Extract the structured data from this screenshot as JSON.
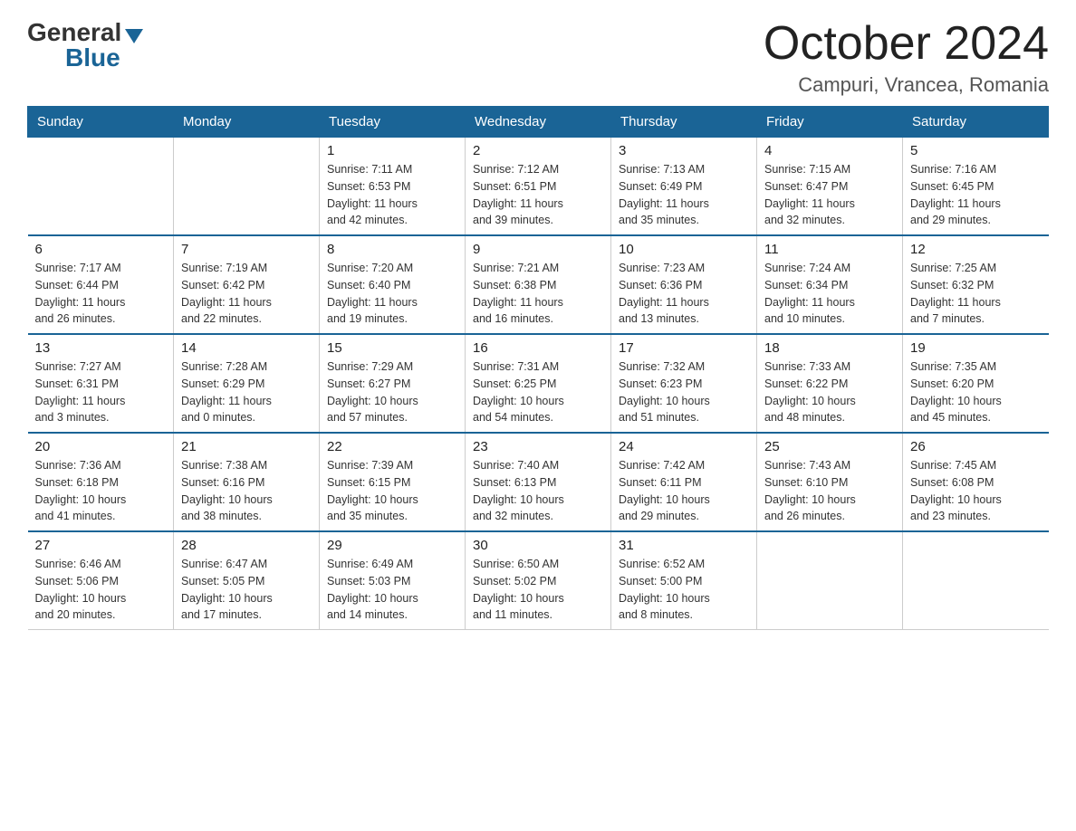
{
  "header": {
    "logo": {
      "general": "General",
      "blue": "Blue"
    },
    "title": "October 2024",
    "location": "Campuri, Vrancea, Romania"
  },
  "days_of_week": [
    "Sunday",
    "Monday",
    "Tuesday",
    "Wednesday",
    "Thursday",
    "Friday",
    "Saturday"
  ],
  "weeks": [
    [
      {
        "day": "",
        "info": ""
      },
      {
        "day": "",
        "info": ""
      },
      {
        "day": "1",
        "info": "Sunrise: 7:11 AM\nSunset: 6:53 PM\nDaylight: 11 hours\nand 42 minutes."
      },
      {
        "day": "2",
        "info": "Sunrise: 7:12 AM\nSunset: 6:51 PM\nDaylight: 11 hours\nand 39 minutes."
      },
      {
        "day": "3",
        "info": "Sunrise: 7:13 AM\nSunset: 6:49 PM\nDaylight: 11 hours\nand 35 minutes."
      },
      {
        "day": "4",
        "info": "Sunrise: 7:15 AM\nSunset: 6:47 PM\nDaylight: 11 hours\nand 32 minutes."
      },
      {
        "day": "5",
        "info": "Sunrise: 7:16 AM\nSunset: 6:45 PM\nDaylight: 11 hours\nand 29 minutes."
      }
    ],
    [
      {
        "day": "6",
        "info": "Sunrise: 7:17 AM\nSunset: 6:44 PM\nDaylight: 11 hours\nand 26 minutes."
      },
      {
        "day": "7",
        "info": "Sunrise: 7:19 AM\nSunset: 6:42 PM\nDaylight: 11 hours\nand 22 minutes."
      },
      {
        "day": "8",
        "info": "Sunrise: 7:20 AM\nSunset: 6:40 PM\nDaylight: 11 hours\nand 19 minutes."
      },
      {
        "day": "9",
        "info": "Sunrise: 7:21 AM\nSunset: 6:38 PM\nDaylight: 11 hours\nand 16 minutes."
      },
      {
        "day": "10",
        "info": "Sunrise: 7:23 AM\nSunset: 6:36 PM\nDaylight: 11 hours\nand 13 minutes."
      },
      {
        "day": "11",
        "info": "Sunrise: 7:24 AM\nSunset: 6:34 PM\nDaylight: 11 hours\nand 10 minutes."
      },
      {
        "day": "12",
        "info": "Sunrise: 7:25 AM\nSunset: 6:32 PM\nDaylight: 11 hours\nand 7 minutes."
      }
    ],
    [
      {
        "day": "13",
        "info": "Sunrise: 7:27 AM\nSunset: 6:31 PM\nDaylight: 11 hours\nand 3 minutes."
      },
      {
        "day": "14",
        "info": "Sunrise: 7:28 AM\nSunset: 6:29 PM\nDaylight: 11 hours\nand 0 minutes."
      },
      {
        "day": "15",
        "info": "Sunrise: 7:29 AM\nSunset: 6:27 PM\nDaylight: 10 hours\nand 57 minutes."
      },
      {
        "day": "16",
        "info": "Sunrise: 7:31 AM\nSunset: 6:25 PM\nDaylight: 10 hours\nand 54 minutes."
      },
      {
        "day": "17",
        "info": "Sunrise: 7:32 AM\nSunset: 6:23 PM\nDaylight: 10 hours\nand 51 minutes."
      },
      {
        "day": "18",
        "info": "Sunrise: 7:33 AM\nSunset: 6:22 PM\nDaylight: 10 hours\nand 48 minutes."
      },
      {
        "day": "19",
        "info": "Sunrise: 7:35 AM\nSunset: 6:20 PM\nDaylight: 10 hours\nand 45 minutes."
      }
    ],
    [
      {
        "day": "20",
        "info": "Sunrise: 7:36 AM\nSunset: 6:18 PM\nDaylight: 10 hours\nand 41 minutes."
      },
      {
        "day": "21",
        "info": "Sunrise: 7:38 AM\nSunset: 6:16 PM\nDaylight: 10 hours\nand 38 minutes."
      },
      {
        "day": "22",
        "info": "Sunrise: 7:39 AM\nSunset: 6:15 PM\nDaylight: 10 hours\nand 35 minutes."
      },
      {
        "day": "23",
        "info": "Sunrise: 7:40 AM\nSunset: 6:13 PM\nDaylight: 10 hours\nand 32 minutes."
      },
      {
        "day": "24",
        "info": "Sunrise: 7:42 AM\nSunset: 6:11 PM\nDaylight: 10 hours\nand 29 minutes."
      },
      {
        "day": "25",
        "info": "Sunrise: 7:43 AM\nSunset: 6:10 PM\nDaylight: 10 hours\nand 26 minutes."
      },
      {
        "day": "26",
        "info": "Sunrise: 7:45 AM\nSunset: 6:08 PM\nDaylight: 10 hours\nand 23 minutes."
      }
    ],
    [
      {
        "day": "27",
        "info": "Sunrise: 6:46 AM\nSunset: 5:06 PM\nDaylight: 10 hours\nand 20 minutes."
      },
      {
        "day": "28",
        "info": "Sunrise: 6:47 AM\nSunset: 5:05 PM\nDaylight: 10 hours\nand 17 minutes."
      },
      {
        "day": "29",
        "info": "Sunrise: 6:49 AM\nSunset: 5:03 PM\nDaylight: 10 hours\nand 14 minutes."
      },
      {
        "day": "30",
        "info": "Sunrise: 6:50 AM\nSunset: 5:02 PM\nDaylight: 10 hours\nand 11 minutes."
      },
      {
        "day": "31",
        "info": "Sunrise: 6:52 AM\nSunset: 5:00 PM\nDaylight: 10 hours\nand 8 minutes."
      },
      {
        "day": "",
        "info": ""
      },
      {
        "day": "",
        "info": ""
      }
    ]
  ]
}
